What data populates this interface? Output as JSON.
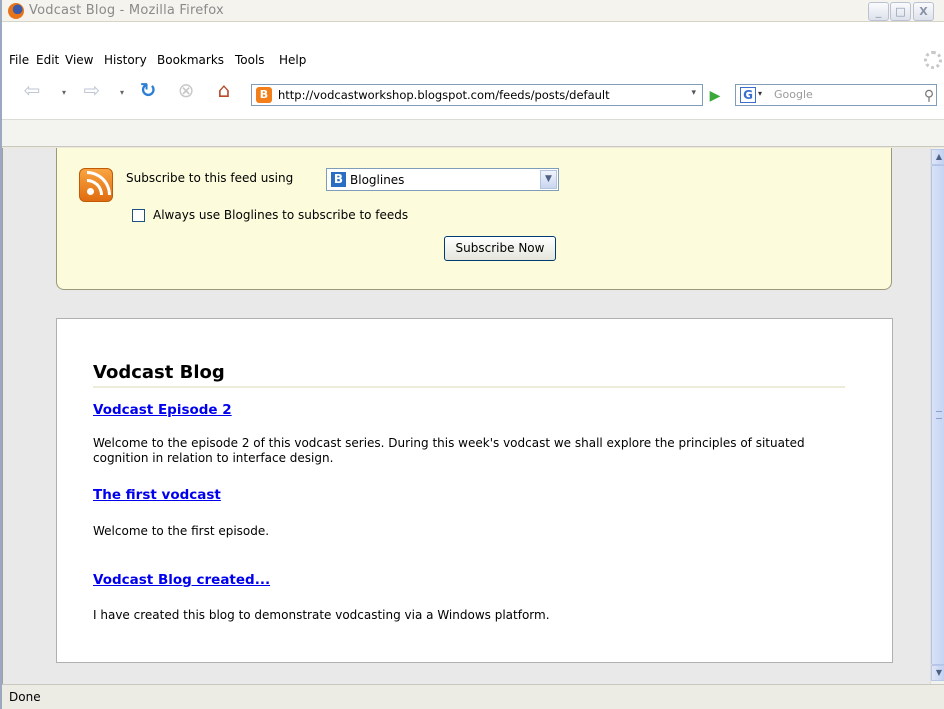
{
  "window": {
    "title": "Vodcast Blog - Mozilla Firefox",
    "min_label": "_",
    "max_label": "□",
    "close_label": "X"
  },
  "menu": {
    "items": [
      "File",
      "Edit",
      "View",
      "History",
      "Bookmarks",
      "Tools",
      "Help"
    ]
  },
  "nav": {
    "back_glyph": "⇦",
    "forward_glyph": "⇨",
    "reload_glyph": "↻",
    "stop_glyph": "⊗",
    "home_glyph": "⌂",
    "dropdown_glyph": "▾",
    "url": "http://vodcastworkshop.blogspot.com/feeds/posts/default",
    "favicon_letter": "B",
    "go_glyph": "▶",
    "search_engine_letter": "G",
    "search_placeholder": "Google",
    "search_glyph": "⚲"
  },
  "subscribe": {
    "label": "Subscribe to this feed using",
    "reader": "Bloglines",
    "reader_icon_letter": "B",
    "select_arrow": "▼",
    "always_label": "Always use Bloglines to subscribe to feeds",
    "always_checked": false,
    "button_label": "Subscribe Now"
  },
  "feed": {
    "title": "Vodcast Blog",
    "entries": [
      {
        "title": "Vodcast Episode 2",
        "summary": "Welcome to the episode 2 of this vodcast series. During this week's vodcast we shall explore the principles of situated cognition in relation to interface design."
      },
      {
        "title": "The first vodcast",
        "summary": "Welcome to the first episode."
      },
      {
        "title": "Vodcast Blog created...",
        "summary": "I have created this blog to demonstrate vodcasting via a Windows platform."
      }
    ]
  },
  "scrollbar": {
    "up_glyph": "▲",
    "down_glyph": "▼"
  },
  "status": {
    "text": "Done"
  },
  "colors": {
    "link": "#0000ee",
    "feed_box_bg": "#fcfcdc",
    "rss_orange": "#f39a2a"
  }
}
